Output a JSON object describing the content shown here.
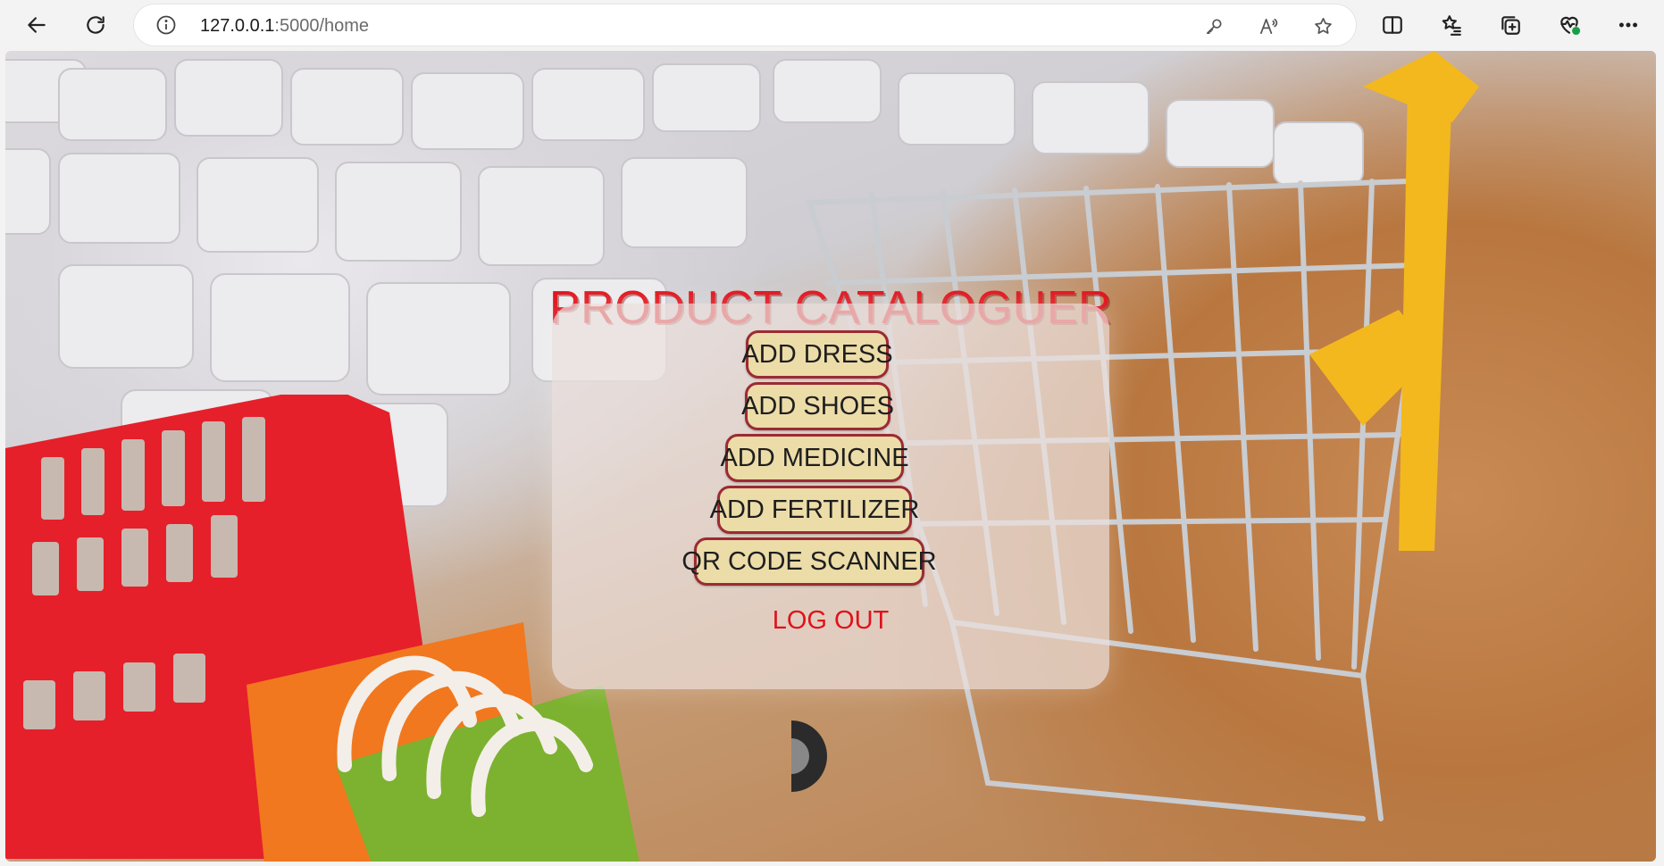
{
  "browser": {
    "url_host": "127.0.0.1",
    "url_path": ":5000/home",
    "icons": {
      "back": "back-arrow-icon",
      "refresh": "refresh-icon",
      "info": "site-info-icon",
      "key": "password-key-icon",
      "read_aloud": "read-aloud-icon",
      "favorite": "favorite-star-icon",
      "split": "split-screen-icon",
      "favorites": "favorites-list-icon",
      "collections": "collections-icon",
      "health": "browser-essentials-icon",
      "more": "more-menu-icon"
    }
  },
  "page": {
    "title": "PRODUCT CATALOGUER",
    "buttons": {
      "add_dress": "ADD DRESS",
      "add_shoes": "ADD SHOES",
      "add_medicine": "ADD MEDICINE",
      "add_fertilizer": "ADD FERTILIZER",
      "qr_scanner": "QR CODE SCANNER"
    },
    "logout": "LOG OUT"
  },
  "colors": {
    "title_red": "#e0121b",
    "button_fill": "#ecdca8",
    "button_border": "#9b2b33"
  }
}
